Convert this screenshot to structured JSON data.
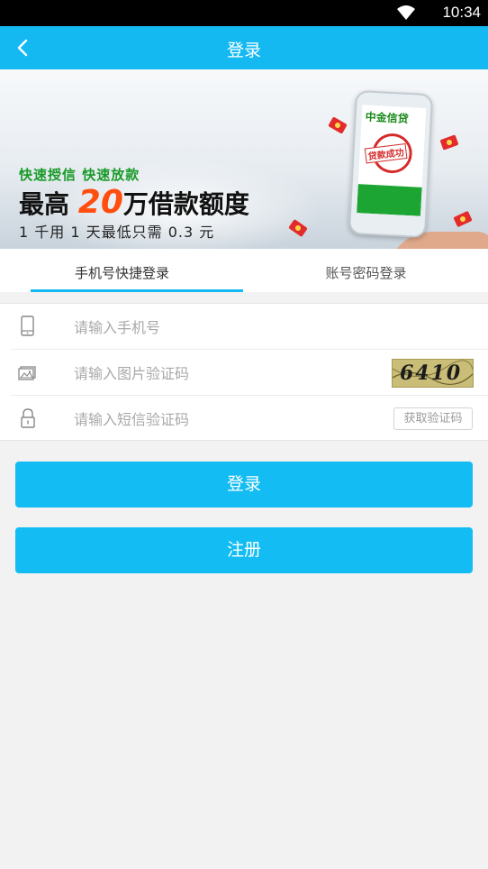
{
  "status_bar": {
    "time": "10:34"
  },
  "header": {
    "title": "登录"
  },
  "banner": {
    "line1": "快速授信 快速放款",
    "line2_prefix": "最高",
    "line2_number": "20",
    "line2_suffix": "万借款额度",
    "line3": "1 千用 1 天最低只需 0.3 元",
    "phone_brand": "中金信贷",
    "phone_stamp": "贷款成功"
  },
  "tabs": [
    {
      "label": "手机号快捷登录",
      "active": true
    },
    {
      "label": "账号密码登录",
      "active": false
    }
  ],
  "form": {
    "phone_placeholder": "请输入手机号",
    "captcha_placeholder": "请输入图片验证码",
    "captcha_text": "6410",
    "sms_placeholder": "请输入短信验证码",
    "sms_button": "获取验证码"
  },
  "buttons": {
    "login": "登录",
    "register": "注册"
  },
  "colors": {
    "accent": "#14b9f2",
    "button": "#13bdf3",
    "background": "#f2f2f2"
  }
}
